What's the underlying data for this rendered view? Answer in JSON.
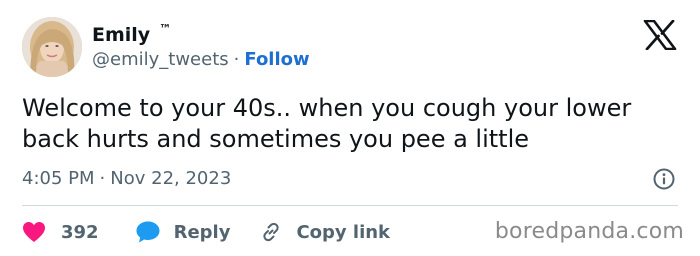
{
  "author": {
    "display_name": "Emily",
    "badge": "™",
    "handle": "@emily_tweets",
    "separator": "·",
    "follow_label": "Follow"
  },
  "tweet": {
    "text": "Welcome to your 40s.. when you cough your lower back hurts and sometimes you pee a little",
    "time": "4:05 PM",
    "date": "Nov 22, 2023",
    "separator": "·"
  },
  "actions": {
    "like_count": "392",
    "reply_label": "Reply",
    "copy_link_label": "Copy link"
  },
  "icons": {
    "avatar": "profile-photo",
    "logo": "x-logo-icon",
    "info": "info-icon",
    "like": "heart-icon",
    "reply": "speech-bubble-icon",
    "copy": "link-icon"
  },
  "watermark": "boredpanda.com",
  "colors": {
    "like": "#f91880",
    "reply": "#1d9bf0",
    "follow": "#1d6fd1",
    "muted": "#536471",
    "text": "#0f1419",
    "divider": "#cfd9de",
    "watermark": "#8a8a8a"
  }
}
